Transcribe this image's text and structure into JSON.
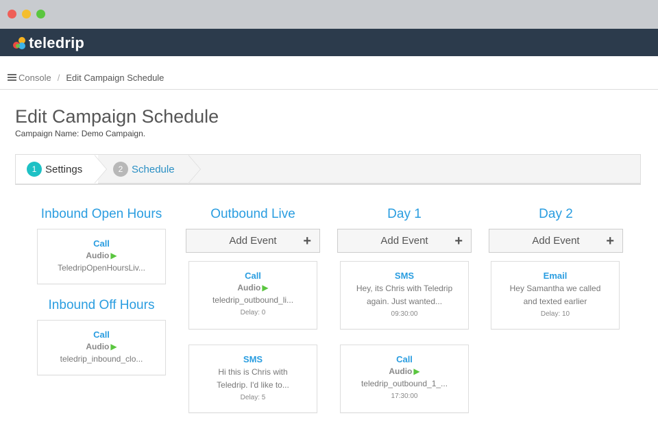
{
  "app": {
    "logo_text": "teledrip"
  },
  "breadcrumb": {
    "home": "Console",
    "separator": "/",
    "current": "Edit Campaign Schedule"
  },
  "page": {
    "title": "Edit Campaign Schedule",
    "campaign_name": "Campaign Name: Demo Campaign."
  },
  "wizard": {
    "steps": [
      {
        "number": "1",
        "label": "Settings"
      },
      {
        "number": "2",
        "label": "Schedule"
      }
    ]
  },
  "columns": {
    "inbound_open": {
      "title": "Inbound Open Hours",
      "card": {
        "type": "Call",
        "audio": "Audio",
        "text": "TeledripOpenHoursLiv..."
      }
    },
    "inbound_off": {
      "title": "Inbound Off Hours",
      "card": {
        "type": "Call",
        "audio": "Audio",
        "text": "teledrip_inbound_clo..."
      }
    },
    "outbound_live": {
      "title": "Outbound Live",
      "add_label": "Add Event",
      "cards": [
        {
          "type": "Call",
          "audio": "Audio",
          "text": "teledrip_outbound_li...",
          "delay": "Delay: 0"
        },
        {
          "type": "SMS",
          "line1": "Hi this is Chris with",
          "line2": "Teledrip. I'd like to...",
          "delay": "Delay: 5"
        }
      ]
    },
    "day1": {
      "title": "Day 1",
      "add_label": "Add Event",
      "cards": [
        {
          "type": "SMS",
          "line1": "Hey, its Chris with Teledrip",
          "line2": "again. Just wanted...",
          "delay": "09:30:00"
        },
        {
          "type": "Call",
          "audio": "Audio",
          "text": "teledrip_outbound_1_...",
          "delay": "17:30:00"
        }
      ]
    },
    "day2": {
      "title": "Day 2",
      "add_label": "Add Event",
      "cards": [
        {
          "type": "Email",
          "line1": "Hey Samantha we called",
          "line2": "and texted earlier",
          "delay": "Delay: 10"
        }
      ]
    }
  },
  "icons": {
    "plus": "+",
    "play": "▶"
  },
  "colors": {
    "accent": "#2a9de0",
    "navbar": "#2c3b4c",
    "step_active": "#1ec1c5",
    "play": "#5ac63f"
  }
}
